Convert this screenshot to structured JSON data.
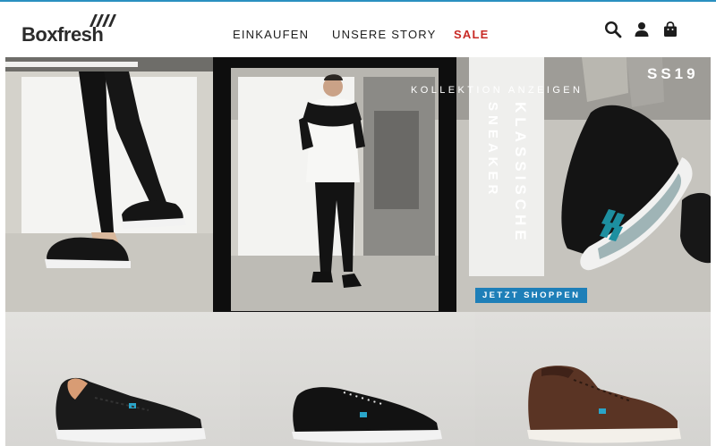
{
  "brand": {
    "name": "Boxfresh",
    "accent": "#2a90c0"
  },
  "nav": {
    "items": [
      {
        "label": "EINKAUFEN"
      },
      {
        "label": "UNSERE STORY"
      },
      {
        "label": "SALE",
        "color": "#c82a25"
      }
    ]
  },
  "header_icons": [
    "search-icon",
    "account-icon",
    "shopping-bag-icon"
  ],
  "hero": {
    "kollektion_link": "KOLLEKTION ANZEIGEN",
    "season": "SS19",
    "headline_1": "KLASSISCHE",
    "headline_2": "SNEAKER",
    "cta_label": "JETZT SHOPPEN",
    "cta_color": "#1e7fb8"
  },
  "products": [
    {
      "color_name": "black-canvas",
      "color": "#1a1a1a"
    },
    {
      "color_name": "black-leather",
      "color": "#111111"
    },
    {
      "color_name": "brown-mid",
      "color": "#5a3424"
    }
  ]
}
